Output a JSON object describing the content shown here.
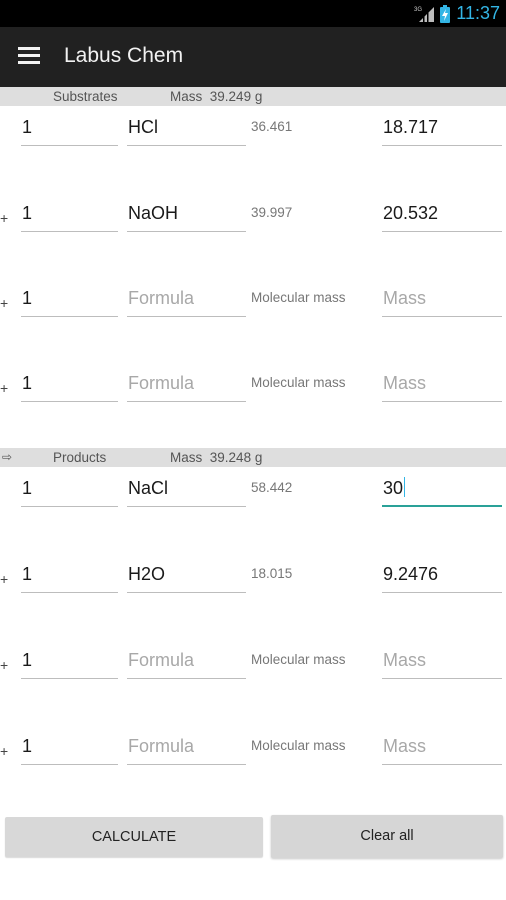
{
  "status_bar": {
    "network_label": "3G",
    "time": "11:37",
    "icons": [
      "signal-icon",
      "battery-icon"
    ],
    "accent_color": "#33b5e5"
  },
  "action_bar": {
    "title": "Labus Chem",
    "menu_icon": "hamburger-menu-icon",
    "background_color": "#212121"
  },
  "substrates": {
    "label": "Substrates",
    "mass_label": "Mass",
    "mass_value": "39.249 g",
    "rows": [
      {
        "plus": "",
        "coefficient": "1",
        "formula": "HCl",
        "formula_placeholder": "Formula",
        "molecular_mass": "36.461",
        "molecular_mass_placeholder": "Molecular mass",
        "mass": "18.717",
        "mass_placeholder": "Mass"
      },
      {
        "plus": "+",
        "coefficient": "1",
        "formula": "NaOH",
        "formula_placeholder": "Formula",
        "molecular_mass": "39.997",
        "molecular_mass_placeholder": "Molecular mass",
        "mass": "20.532",
        "mass_placeholder": "Mass"
      },
      {
        "plus": "+",
        "coefficient": "1",
        "formula": "",
        "formula_placeholder": "Formula",
        "molecular_mass": "",
        "molecular_mass_placeholder": "Molecular mass",
        "mass": "",
        "mass_placeholder": "Mass"
      },
      {
        "plus": "+",
        "coefficient": "1",
        "formula": "",
        "formula_placeholder": "Formula",
        "molecular_mass": "",
        "molecular_mass_placeholder": "Molecular mass",
        "mass": "",
        "mass_placeholder": "Mass"
      }
    ]
  },
  "products": {
    "arrow": "⇨",
    "label": "Products",
    "mass_label": "Mass",
    "mass_value": "39.248 g",
    "rows": [
      {
        "plus": "",
        "coefficient": "1",
        "formula": "NaCl",
        "formula_placeholder": "Formula",
        "molecular_mass": "58.442",
        "molecular_mass_placeholder": "Molecular mass",
        "mass": "30",
        "mass_placeholder": "Mass",
        "focused": true
      },
      {
        "plus": "+",
        "coefficient": "1",
        "formula": "H2O",
        "formula_placeholder": "Formula",
        "molecular_mass": "18.015",
        "molecular_mass_placeholder": "Molecular mass",
        "mass": "9.2476",
        "mass_placeholder": "Mass"
      },
      {
        "plus": "+",
        "coefficient": "1",
        "formula": "",
        "formula_placeholder": "Formula",
        "molecular_mass": "",
        "molecular_mass_placeholder": "Molecular mass",
        "mass": "",
        "mass_placeholder": "Mass"
      },
      {
        "plus": "+",
        "coefficient": "1",
        "formula": "",
        "formula_placeholder": "Formula",
        "molecular_mass": "",
        "molecular_mass_placeholder": "Molecular mass",
        "mass": "",
        "mass_placeholder": "Mass"
      }
    ]
  },
  "buttons": {
    "calculate": "CALCULATE",
    "clear_all": "Clear all"
  },
  "colors": {
    "section_header_bg": "#dedede",
    "focused_underline": "#2aa198",
    "placeholder_text": "#a8a8a8"
  }
}
